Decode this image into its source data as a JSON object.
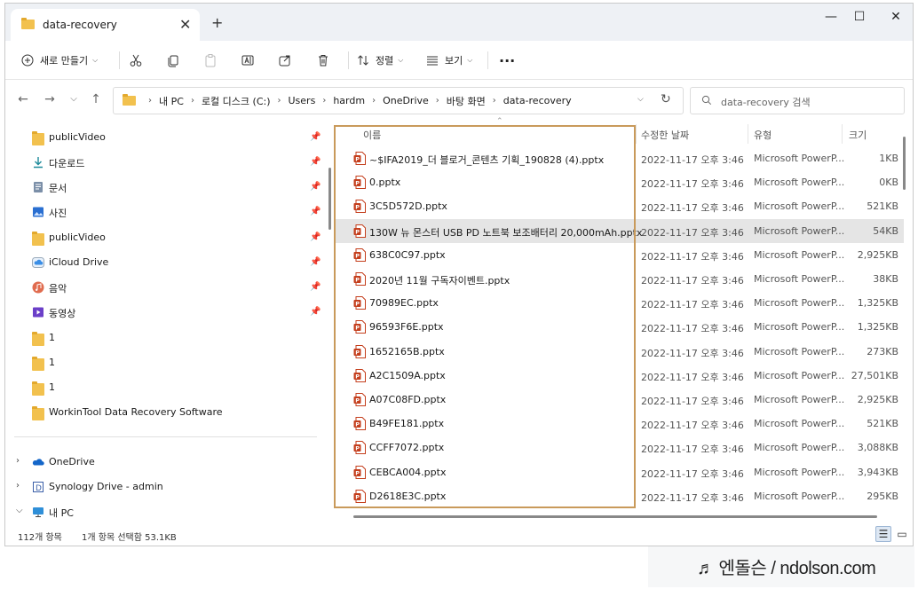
{
  "tab": {
    "title": "data-recovery"
  },
  "toolbar": {
    "new_label": "새로 만들기",
    "sort_label": "정렬",
    "view_label": "보기",
    "more_label": "···"
  },
  "address": {
    "crumbs": [
      "내 PC",
      "로컬 디스크 (C:)",
      "Users",
      "hardm",
      "OneDrive",
      "바탕 화면",
      "data-recovery"
    ]
  },
  "search": {
    "placeholder": "data-recovery 검색"
  },
  "sidebar": {
    "items": [
      {
        "label": "publicVideo",
        "icon": "folder-icon",
        "pinned": true
      },
      {
        "label": "다운로드",
        "icon": "download-icon",
        "pinned": true
      },
      {
        "label": "문서",
        "icon": "document-icon",
        "pinned": true
      },
      {
        "label": "사진",
        "icon": "picture-icon",
        "pinned": true
      },
      {
        "label": "publicVideo",
        "icon": "folder-icon",
        "pinned": true
      },
      {
        "label": "iCloud Drive",
        "icon": "icloud-icon",
        "pinned": true
      },
      {
        "label": "음악",
        "icon": "music-icon",
        "pinned": true
      },
      {
        "label": "동영상",
        "icon": "video-icon",
        "pinned": true
      },
      {
        "label": "1",
        "icon": "folder-icon"
      },
      {
        "label": "1",
        "icon": "folder-icon"
      },
      {
        "label": "1",
        "icon": "folder-icon"
      },
      {
        "label": "WorkinTool Data Recovery Software",
        "icon": "folder-icon"
      }
    ],
    "tree": [
      {
        "label": "OneDrive",
        "icon": "onedrive-icon",
        "expanded": false
      },
      {
        "label": "Synology Drive - admin",
        "icon": "synology-icon",
        "expanded": false
      },
      {
        "label": "내 PC",
        "icon": "pc-icon",
        "expanded": true
      }
    ]
  },
  "columns": {
    "name": "이름",
    "date": "수정한 날짜",
    "type": "유형",
    "size": "크기"
  },
  "files": [
    {
      "name": "~$IFA2019_더 블로거_콘텐츠 기획_190828 (4).pptx",
      "date": "2022-11-17 오후 3:46",
      "type": "Microsoft PowerP...",
      "size": "1KB"
    },
    {
      "name": "0.pptx",
      "date": "2022-11-17 오후 3:46",
      "type": "Microsoft PowerP...",
      "size": "0KB"
    },
    {
      "name": "3C5D572D.pptx",
      "date": "2022-11-17 오후 3:46",
      "type": "Microsoft PowerP...",
      "size": "521KB"
    },
    {
      "name": "130W 뉴 몬스터 USB PD 노트북 보조배터리 20,000mAh.pptx",
      "date": "2022-11-17 오후 3:46",
      "type": "Microsoft PowerP...",
      "size": "54KB",
      "selected": true
    },
    {
      "name": "638C0C97.pptx",
      "date": "2022-11-17 오후 3:46",
      "type": "Microsoft PowerP...",
      "size": "2,925KB"
    },
    {
      "name": "2020년 11월 구독자이벤트.pptx",
      "date": "2022-11-17 오후 3:46",
      "type": "Microsoft PowerP...",
      "size": "38KB"
    },
    {
      "name": "70989EC.pptx",
      "date": "2022-11-17 오후 3:46",
      "type": "Microsoft PowerP...",
      "size": "1,325KB"
    },
    {
      "name": "96593F6E.pptx",
      "date": "2022-11-17 오후 3:46",
      "type": "Microsoft PowerP...",
      "size": "1,325KB"
    },
    {
      "name": "1652165B.pptx",
      "date": "2022-11-17 오후 3:46",
      "type": "Microsoft PowerP...",
      "size": "273KB"
    },
    {
      "name": "A2C1509A.pptx",
      "date": "2022-11-17 오후 3:46",
      "type": "Microsoft PowerP...",
      "size": "27,501KB"
    },
    {
      "name": "A07C08FD.pptx",
      "date": "2022-11-17 오후 3:46",
      "type": "Microsoft PowerP...",
      "size": "2,925KB"
    },
    {
      "name": "B49FE181.pptx",
      "date": "2022-11-17 오후 3:46",
      "type": "Microsoft PowerP...",
      "size": "521KB"
    },
    {
      "name": "CCFF7072.pptx",
      "date": "2022-11-17 오후 3:46",
      "type": "Microsoft PowerP...",
      "size": "3,088KB"
    },
    {
      "name": "CEBCA004.pptx",
      "date": "2022-11-17 오후 3:46",
      "type": "Microsoft PowerP...",
      "size": "3,943KB"
    },
    {
      "name": "D2618E3C.pptx",
      "date": "2022-11-17 오후 3:46",
      "type": "Microsoft PowerP...",
      "size": "295KB"
    }
  ],
  "status": {
    "count": "112개 항목",
    "selection": "1개 항목 선택함 53.1KB"
  },
  "watermark": "♬ 엔돌슨 / ndolson.com",
  "colors": {
    "folder": "#f2c14e",
    "pptx": "#c43e1c",
    "highlight": "#c99a5b",
    "selected_row": "#e5e5e5"
  }
}
